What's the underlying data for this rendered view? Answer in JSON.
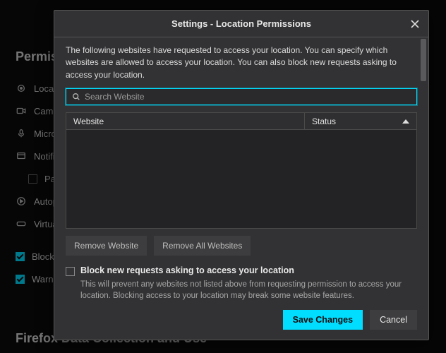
{
  "background": {
    "section_title": "Permissions",
    "items": {
      "location": "Location",
      "camera": "Camera",
      "microphone": "Microphone",
      "notifications": "Notifications",
      "pause": "Pause notifications until Firefox restarts",
      "autoplay": "Autoplay",
      "virtual": "Virtual Reality"
    },
    "block_popups": "Block pop-up windows",
    "warn_addons": "Warn you when websites try to install add-ons",
    "section2_title": "Firefox Data Collection and Use"
  },
  "modal": {
    "title": "Settings - Location Permissions",
    "description": "The following websites have requested to access your location. You can specify which websites are allowed to access your location. You can also block new requests asking to access your location.",
    "search_placeholder": "Search Website",
    "col_website": "Website",
    "col_status": "Status",
    "remove_one": "Remove Website",
    "remove_all": "Remove All Websites",
    "block_label": "Block new requests asking to access your location",
    "block_help": "This will prevent any websites not listed above from requesting permission to access your location. Blocking access to your location may break some website features.",
    "save": "Save Changes",
    "cancel": "Cancel"
  }
}
